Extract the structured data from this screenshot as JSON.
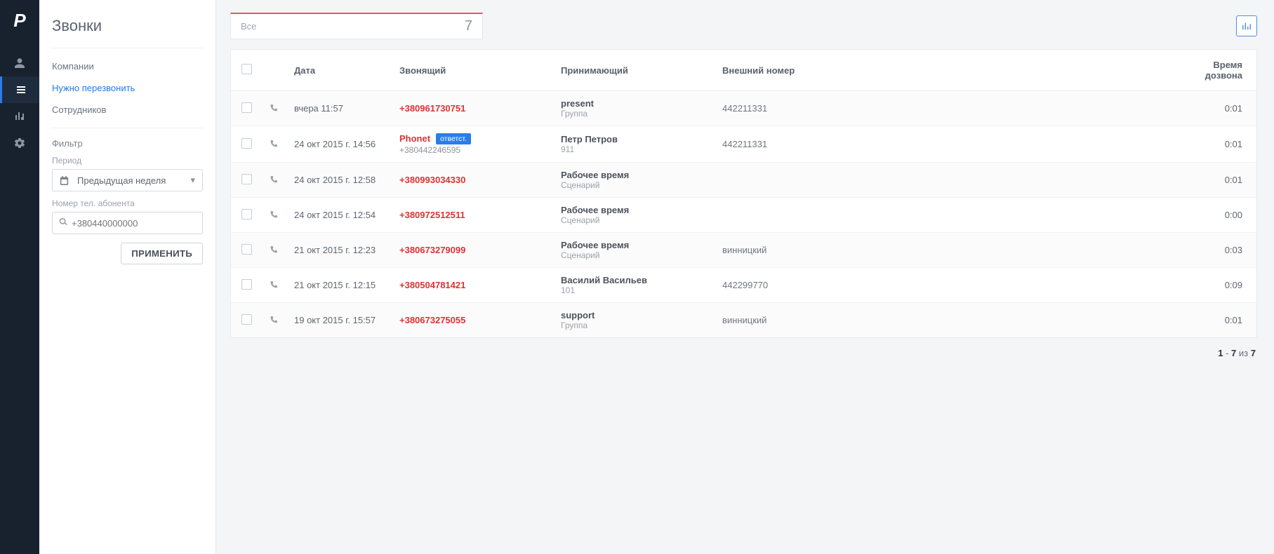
{
  "rail": {
    "logo": "P"
  },
  "sidebar": {
    "title": "Звонки",
    "links": {
      "companies": "Компании",
      "callback": "Нужно перезвонить",
      "employees": "Сотрудников"
    },
    "filter_label": "Фильтр",
    "period_label": "Период",
    "period_value": "Предыдущая неделя",
    "phone_label": "Номер тел. абонента",
    "phone_placeholder": "+380440000000",
    "apply": "ПРИМЕНИТЬ"
  },
  "topbar": {
    "tab_label": "Все",
    "tab_count": "7"
  },
  "table": {
    "headers": {
      "date": "Дата",
      "caller": "Звонящий",
      "receiver": "Принимающий",
      "external": "Внешний номер",
      "duration": "Время дозвона"
    },
    "rows": [
      {
        "date": "вчера 11:57",
        "caller_name": "",
        "caller_num": "+380961730751",
        "caller_sub": "",
        "tag": "",
        "recv_name": "present",
        "recv_sub": "Группа",
        "external": "442211331",
        "duration": "0:01"
      },
      {
        "date": "24 окт 2015 г. 14:56",
        "caller_name": "Phonet",
        "caller_num": "",
        "caller_sub": "+380442246595",
        "tag": "ответст.",
        "recv_name": "Петр Петров",
        "recv_sub": "911",
        "external": "442211331",
        "duration": "0:01"
      },
      {
        "date": "24 окт 2015 г. 12:58",
        "caller_name": "",
        "caller_num": "+380993034330",
        "caller_sub": "",
        "tag": "",
        "recv_name": "Рабочее время",
        "recv_sub": "Сценарий",
        "external": "",
        "duration": "0:01"
      },
      {
        "date": "24 окт 2015 г. 12:54",
        "caller_name": "",
        "caller_num": "+380972512511",
        "caller_sub": "",
        "tag": "",
        "recv_name": "Рабочее время",
        "recv_sub": "Сценарий",
        "external": "",
        "duration": "0:00"
      },
      {
        "date": "21 окт 2015 г. 12:23",
        "caller_name": "",
        "caller_num": "+380673279099",
        "caller_sub": "",
        "tag": "",
        "recv_name": "Рабочее время",
        "recv_sub": "Сценарий",
        "external": "винницкий",
        "duration": "0:03"
      },
      {
        "date": "21 окт 2015 г. 12:15",
        "caller_name": "",
        "caller_num": "+380504781421",
        "caller_sub": "",
        "tag": "",
        "recv_name": "Василий Васильев",
        "recv_sub": "101",
        "external": "442299770",
        "duration": "0:09"
      },
      {
        "date": "19 окт 2015 г. 15:57",
        "caller_name": "",
        "caller_num": "+380673275055",
        "caller_sub": "",
        "tag": "",
        "recv_name": "support",
        "recv_sub": "Группа",
        "external": "винницкий",
        "duration": "0:01"
      }
    ]
  },
  "pager": {
    "from": "1",
    "to": "7",
    "of_label": "из",
    "total": "7"
  }
}
